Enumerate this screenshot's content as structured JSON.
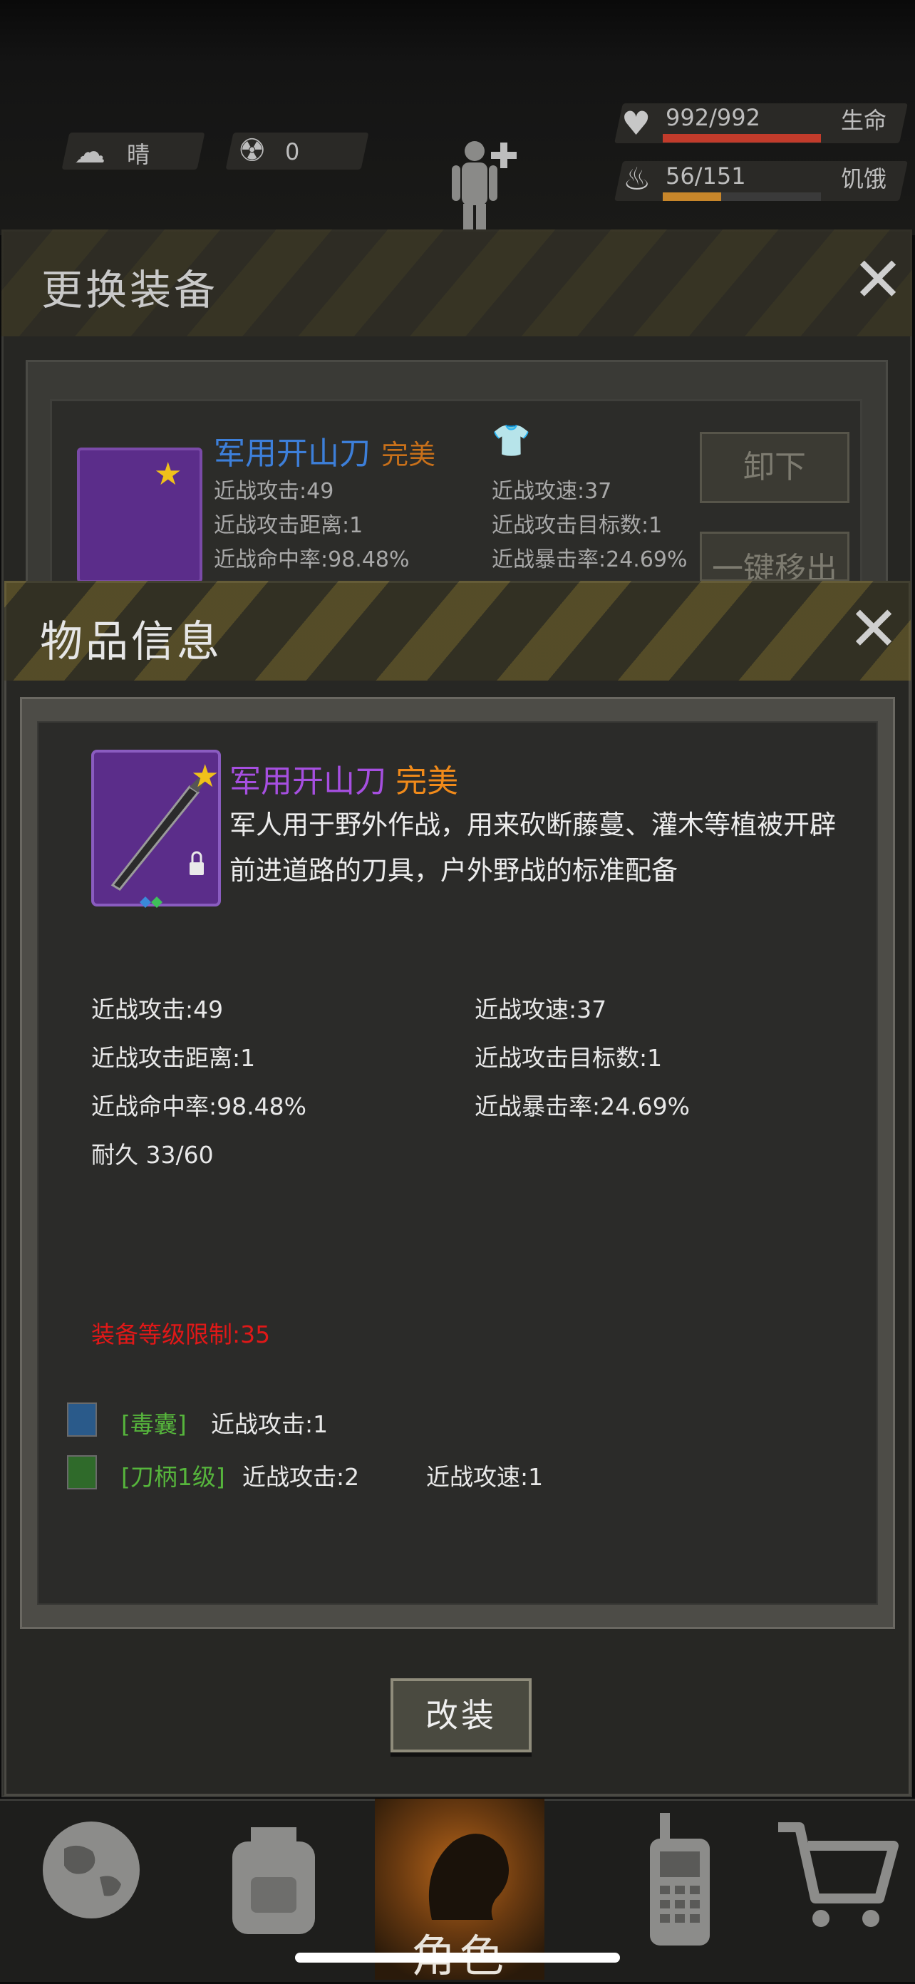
{
  "hud": {
    "weather_icon": "cloud-sun-icon",
    "weather": "晴",
    "radiation_icon": "radiation-icon",
    "radiation": "0",
    "character_icon": "body-plus-icon",
    "health_value": "992/992",
    "health_label": "生命",
    "health_fraction": 1.0,
    "hunger_value": "56/151",
    "hunger_label": "饥饿",
    "hunger_fraction": 0.37,
    "colors": {
      "health": "#c23b2b",
      "hunger": "#c8862a"
    }
  },
  "change_panel": {
    "title": "更换装备",
    "item": {
      "name": "军用开山刀",
      "quality": "完美",
      "stats": [
        "近战攻击:49",
        "近战攻速:37",
        "近战攻击距离:1",
        "近战攻击目标数:1",
        "近战命中率:98.48%",
        "近战暴击率:24.69%"
      ]
    },
    "unequip_label": "卸下",
    "move_out_label": "一键移出"
  },
  "item_info": {
    "title": "物品信息",
    "name": "军用开山刀",
    "quality": "完美",
    "description": "军人用于野外作战，用来砍断藤蔓、灌木等植被开辟前进道路的刀具，户外野战的标准配备",
    "stats": {
      "melee_attack": "近战攻击:49",
      "melee_speed": "近战攻速:37",
      "melee_range": "近战攻击距离:1",
      "melee_targets": "近战攻击目标数:1",
      "melee_hit": "近战命中率:98.48%",
      "melee_crit": "近战暴击率:24.69%",
      "durability": "耐久 33/60"
    },
    "level_limit": "装备等级限制:35",
    "mods": [
      {
        "tag": "[毒囊]",
        "icon": "poison-sac-icon",
        "effects": [
          "近战攻击:1"
        ]
      },
      {
        "tag": "[刀柄1级]",
        "icon": "knife-handle-icon",
        "effects": [
          "近战攻击:2",
          "近战攻速:1"
        ]
      }
    ],
    "modify_button": "改装",
    "colors": {
      "name": "#a64fe0",
      "quality": "#f08a1a",
      "limit": "#e01818",
      "mod_tag": "#56b53c"
    }
  },
  "nav": {
    "items": [
      {
        "icon": "globe-icon"
      },
      {
        "icon": "backpack-icon"
      },
      {
        "icon": "character-head-icon",
        "label": "角色",
        "active": true
      },
      {
        "icon": "walkie-talkie-icon"
      },
      {
        "icon": "shopping-cart-icon"
      }
    ]
  }
}
